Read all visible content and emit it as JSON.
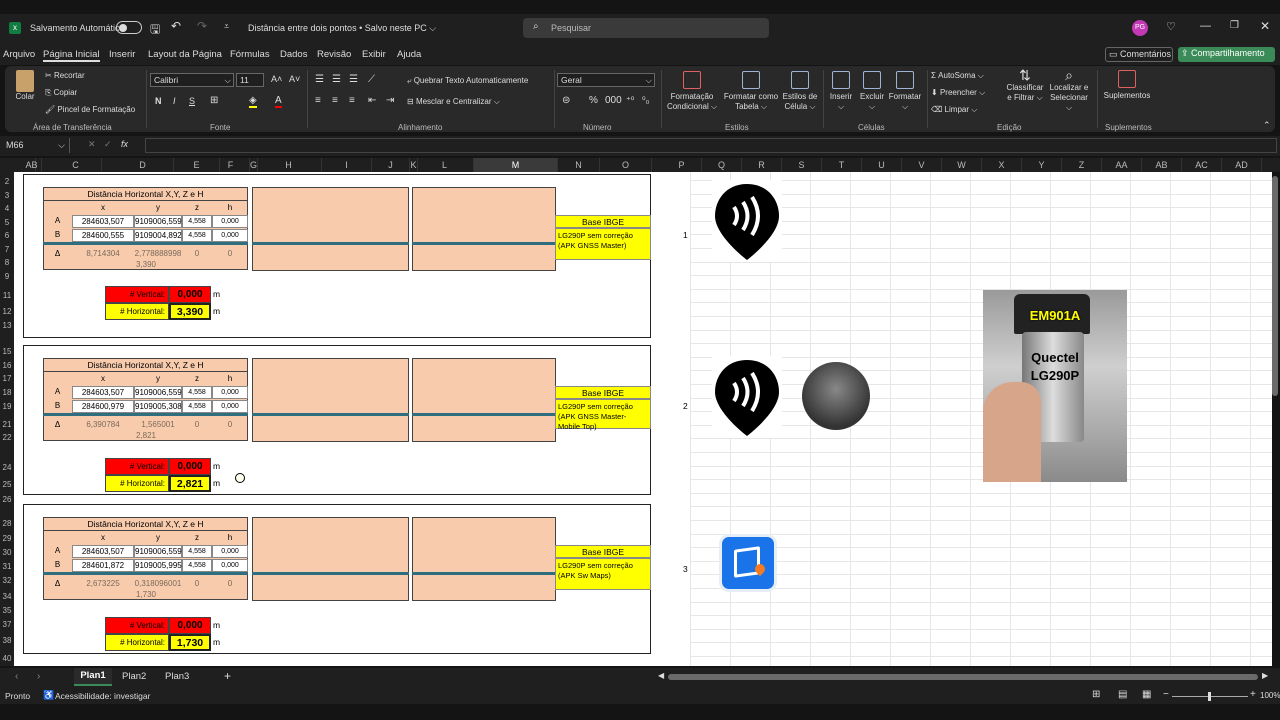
{
  "titlebar": {
    "autosave": "Salvamento Automático",
    "doc_title": "Distância entre dois pontos • Salvo neste PC ⌵",
    "search_placeholder": "Pesquisar",
    "avatar": "PG"
  },
  "menu": [
    "Arquivo",
    "Página Inicial",
    "Inserir",
    "Layout da Página",
    "Fórmulas",
    "Dados",
    "Revisão",
    "Exibir",
    "Ajuda"
  ],
  "comments_btn": "Comentários",
  "share_btn": "Compartilhamento",
  "ribbon": {
    "clipboard": {
      "paste": "Colar",
      "cut": "Recortar",
      "copy": "Copiar",
      "painter": "Pincel de Formatação",
      "group": "Área de Transferência"
    },
    "font": {
      "family": "Calibri",
      "size": "11",
      "group": "Fonte"
    },
    "alignment": {
      "wrap": "Quebrar Texto Automaticamente",
      "merge": "Mesclar e Centralizar",
      "group": "Alinhamento"
    },
    "number": {
      "format": "Geral",
      "group": "Número"
    },
    "styles": {
      "cond": "Formatação Condicional",
      "table": "Formatar como Tabela",
      "cell": "Estilos de Célula",
      "group": "Estilos"
    },
    "cells": {
      "insert": "Inserir",
      "delete": "Excluir",
      "format": "Formatar",
      "group": "Células"
    },
    "editing": {
      "autosum": "AutoSoma",
      "fill": "Preencher",
      "clear": "Limpar",
      "sort": "Classificar e Filtrar",
      "find": "Localizar e Selecionar",
      "group": "Edição"
    },
    "addins": {
      "label": "Suplementos",
      "group": "Suplementos"
    }
  },
  "formula": {
    "namebox": "M66",
    "fx": "fx"
  },
  "columns": [
    "A",
    "B",
    "C",
    "D",
    "E",
    "F",
    "G",
    "H",
    "I",
    "J",
    "K",
    "L",
    "M",
    "N",
    "O",
    "P",
    "Q",
    "R",
    "S",
    "T",
    "U",
    "V",
    "W",
    "X",
    "Y",
    "Z",
    "AA",
    "AB",
    "AC",
    "AD"
  ],
  "rows": [
    "2",
    "3",
    "4",
    "5",
    "6",
    "7",
    "8",
    "9",
    "11",
    "12",
    "13",
    "15",
    "16",
    "17",
    "18",
    "19",
    "21",
    "22",
    "24",
    "25",
    "26",
    "28",
    "29",
    "30",
    "31",
    "32",
    "34",
    "35",
    "37",
    "38",
    "40"
  ],
  "blocks": [
    {
      "title": "Distância Horizontal X,Y, Z e H",
      "headers": [
        "x",
        "y",
        "z",
        "h"
      ],
      "rowA": [
        "A",
        "284603,507",
        "9109006,559",
        "4,558",
        "0,000"
      ],
      "rowB": [
        "B",
        "284600,555",
        "9109004,892",
        "4,558",
        "0,000"
      ],
      "delta": [
        "Δ",
        "8,714304",
        "2,778888998",
        "0",
        "0"
      ],
      "dist": "3,390",
      "base": "Base IBGE",
      "rover": "LG290P sem correção (APK GNSS Master)",
      "vlabel": "# Vertical:",
      "vval": "0,000",
      "hlabel": "# Horizontal:",
      "hval": "3,390",
      "unit": "m",
      "index": "1"
    },
    {
      "title": "Distância Horizontal X,Y, Z e H",
      "headers": [
        "x",
        "y",
        "z",
        "h"
      ],
      "rowA": [
        "A",
        "284603,507",
        "9109006,559",
        "4,558",
        "0,000"
      ],
      "rowB": [
        "B",
        "284600,979",
        "9109005,308",
        "4,558",
        "0,000"
      ],
      "delta": [
        "Δ",
        "6,390784",
        "1,565001",
        "0",
        "0"
      ],
      "dist": "2,821",
      "base": "Base IBGE",
      "rover": "LG290P sem correção (APK GNSS Master-Mobile Top)",
      "vlabel": "# Vertical:",
      "vval": "0,000",
      "hlabel": "# Horizontal:",
      "hval": "2,821",
      "unit": "m",
      "index": "2"
    },
    {
      "title": "Distância Horizontal X,Y, Z e H",
      "headers": [
        "x",
        "y",
        "z",
        "h"
      ],
      "rowA": [
        "A",
        "284603,507",
        "9109006,559",
        "4,558",
        "0,000"
      ],
      "rowB": [
        "B",
        "284601,872",
        "9109005,995",
        "4,558",
        "0,000"
      ],
      "delta": [
        "Δ",
        "2,673225",
        "0,318096001",
        "0",
        "0"
      ],
      "dist": "1,730",
      "base": "Base IBGE",
      "rover": "LG290P sem correção (APK Sw Maps)",
      "vlabel": "# Vertical:",
      "vval": "0,000",
      "hlabel": "# Horizontal:",
      "hval": "1,730",
      "unit": "m",
      "index": "3"
    }
  ],
  "photo": {
    "line1": "EM901A",
    "line2": "Quectel",
    "line3": "LG290P"
  },
  "sheets": [
    "Plan1",
    "Plan2",
    "Plan3"
  ],
  "status": {
    "ready": "Pronto",
    "accessibility": "Acessibilidade: investigar",
    "zoom": "100%"
  }
}
